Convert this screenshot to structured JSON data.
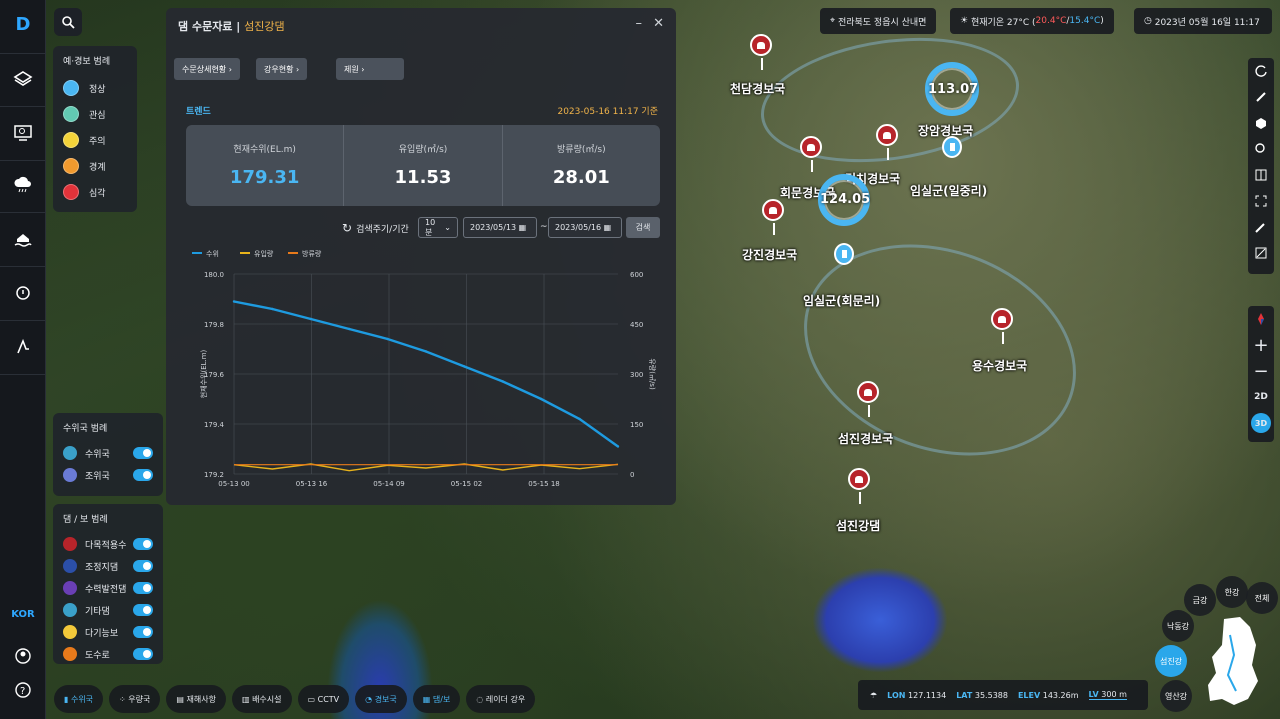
{
  "app": {
    "logo": "D",
    "lang": "KOR"
  },
  "panel": {
    "title": "댐 수문자료 |",
    "subtitle": "섬진강댐",
    "minimize": "–",
    "close": "✕",
    "tabs": [
      "수문상세현황",
      "강우현황",
      "제원"
    ],
    "trend_label": "트렌드",
    "timestamp": "2023-05-16 11:17 기준",
    "stats": [
      {
        "label": "현재수위(EL.m)",
        "value": "179.31"
      },
      {
        "label": "유입량(㎥/s)",
        "value": "11.53"
      },
      {
        "label": "방류량(㎥/s)",
        "value": "28.01"
      }
    ],
    "filter": {
      "label": "검색주기/기간",
      "interval": "10분",
      "start": "2023/05/13",
      "tilde": "~",
      "end": "2023/05/16",
      "search": "검색"
    }
  },
  "chart_data": {
    "type": "line",
    "legend": [
      "수위",
      "유입량",
      "방류량"
    ],
    "colors": [
      "#1e9be0",
      "#e8b31b",
      "#e87a1b"
    ],
    "ylabel_left": "현재수위(EL.m)",
    "ylabel_right": "유량(㎥/s)",
    "ylim_left": [
      179.2,
      180.0
    ],
    "yticks_left": [
      "180.0",
      "179.8",
      "179.6",
      "179.4",
      "179.2"
    ],
    "ylim_right": [
      0,
      600
    ],
    "yticks_right": [
      "600",
      "450",
      "300",
      "150",
      "0"
    ],
    "xticks": [
      "05-13 00",
      "05-13 16",
      "05-14 09",
      "05-15 02",
      "05-15 18"
    ],
    "series": [
      {
        "name": "수위",
        "x_frac": [
          0,
          0.1,
          0.2,
          0.3,
          0.4,
          0.5,
          0.6,
          0.7,
          0.8,
          0.9,
          1.0
        ],
        "values": [
          179.89,
          179.86,
          179.82,
          179.78,
          179.74,
          179.69,
          179.63,
          179.57,
          179.5,
          179.42,
          179.31
        ]
      },
      {
        "name": "유입량",
        "values": [
          28,
          15,
          30,
          10,
          26,
          18,
          30,
          12,
          27,
          16,
          29
        ]
      },
      {
        "name": "방류량",
        "values": [
          28,
          28,
          28,
          28,
          28,
          28,
          28,
          28,
          28,
          28,
          28
        ]
      }
    ]
  },
  "legend_alert": {
    "title": "예·경보 범례",
    "items": [
      {
        "label": "정상",
        "color": "#4ab6f2"
      },
      {
        "label": "관심",
        "color": "#62c9b2"
      },
      {
        "label": "주의",
        "color": "#f3d33a"
      },
      {
        "label": "경계",
        "color": "#f19a2e"
      },
      {
        "label": "심각",
        "color": "#e2333a"
      }
    ]
  },
  "legend_station": {
    "title": "수위국 범례",
    "items": [
      {
        "label": "수위국",
        "color": "#3aa0c9"
      },
      {
        "label": "조위국",
        "color": "#6a7bd6"
      }
    ]
  },
  "legend_dam": {
    "title": "댐 / 보 범례",
    "items": [
      {
        "label": "다목적용수",
        "color": "#b7242a"
      },
      {
        "label": "조정지댐",
        "color": "#2b4fa8"
      },
      {
        "label": "수력발전댐",
        "color": "#6a3fb5"
      },
      {
        "label": "기타댐",
        "color": "#3aa0c9"
      },
      {
        "label": "다기능보",
        "color": "#f3c93a"
      },
      {
        "label": "도수로",
        "color": "#e87a1b"
      }
    ]
  },
  "topbar": {
    "location": "전라북도 정읍시 산내면",
    "weather_label": "현재기온 27°C (",
    "temp_high": "20.4°C",
    "slash": " / ",
    "temp_low": "15.4°C",
    "paren": ")",
    "datetime": "2023년 05월 16일 11:17"
  },
  "bottom": {
    "buttons": [
      "수위국",
      "우량국",
      "재해사항",
      "배수시설",
      "CCTV",
      "경보국",
      "댐/보",
      "레이더 강우"
    ]
  },
  "coords": {
    "lon_k": "LON",
    "lon": "127.1134",
    "lat_k": "LAT",
    "lat": "35.5388",
    "elev_k": "ELEV",
    "elev": "143.26m",
    "lv_k": "LV",
    "lv": "300 m"
  },
  "basins": [
    "한강",
    "금강",
    "전체",
    "낙동강",
    "섬진강",
    "영산강"
  ],
  "map": {
    "labels": [
      "천담경보국",
      "장암경보국",
      "임실군(일중리)",
      "덕치경보국",
      "회문경보국",
      "강진경보국",
      "임실군(회문리)",
      "용수경보국",
      "섬진경보국",
      "섬진강댐"
    ],
    "ring1": "113.07",
    "ring2": "124.05"
  },
  "view": {
    "mode2d": "2D",
    "mode3d": "3D"
  }
}
